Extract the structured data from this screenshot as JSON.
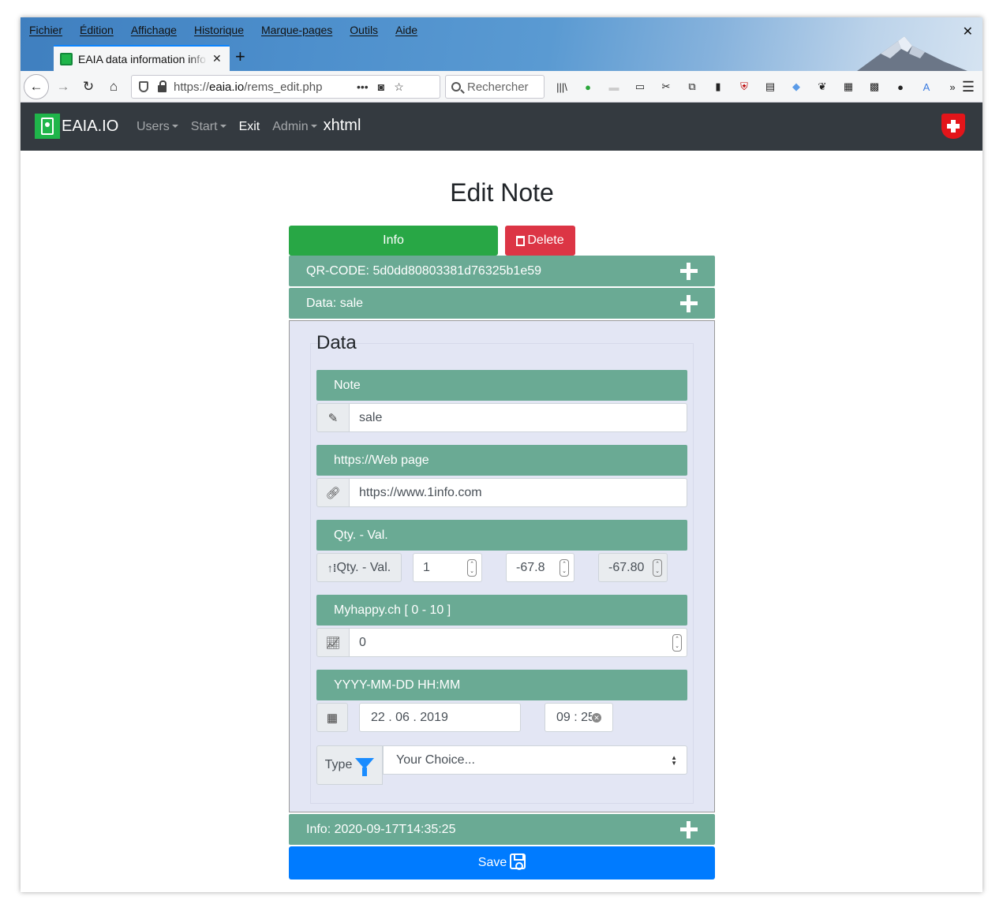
{
  "browser": {
    "menu": [
      "Fichier",
      "Édition",
      "Affichage",
      "Historique",
      "Marque-pages",
      "Outils",
      "Aide"
    ],
    "tab_title": "EAIA data information info",
    "url_prefix": "https://",
    "url_host": "eaia.io",
    "url_path": "/rems_edit.php",
    "search_placeholder": "Rechercher",
    "icons": [
      "back-arrow-icon",
      "forward-arrow-icon",
      "reload-icon",
      "home-icon",
      "library-icon",
      "sidebar-icon",
      "hamburger-menu-icon"
    ]
  },
  "site_nav": {
    "brand": "EAIA.IO",
    "users": "Users",
    "start": "Start",
    "exit": "Exit",
    "admin": "Admin",
    "xhtml": "xhtml",
    "flag_icon": "swiss-flag-icon"
  },
  "page": {
    "title": "Edit Note",
    "info_button": "Info",
    "delete_button": "Delete",
    "qr_header": "QR-CODE: 5d0dd80803381d76325b1e59",
    "data_header": "Data: sale",
    "panel_title": "Data",
    "info_footer": "Info: 2020-09-17T14:35:25",
    "save_button": "Save"
  },
  "form": {
    "note": {
      "label": "Note",
      "value": "sale"
    },
    "web": {
      "label": "https://Web page",
      "value": "https://www.1info.com"
    },
    "qty": {
      "label": "Qty. - Val.",
      "addon": "Qty. - Val.",
      "qty_value": "1",
      "val_value": "-67.8",
      "total_value": "-67.80"
    },
    "happy": {
      "label": "Myhappy.ch [ 0 - 10 ]",
      "value": "0"
    },
    "datetime": {
      "label": "YYYY-MM-DD HH:MM",
      "day": "22",
      "month": "06",
      "year": "2019",
      "hour": "09",
      "minute": "25"
    },
    "type": {
      "label": "Type",
      "selected": "Your Choice..."
    }
  },
  "colors": {
    "accordion": "#6aaa94",
    "info_button": "#28a745",
    "delete_button": "#dc3545",
    "save_button": "#007bff",
    "navbar": "#343a40",
    "panel_bg": "#e3e6f4"
  }
}
